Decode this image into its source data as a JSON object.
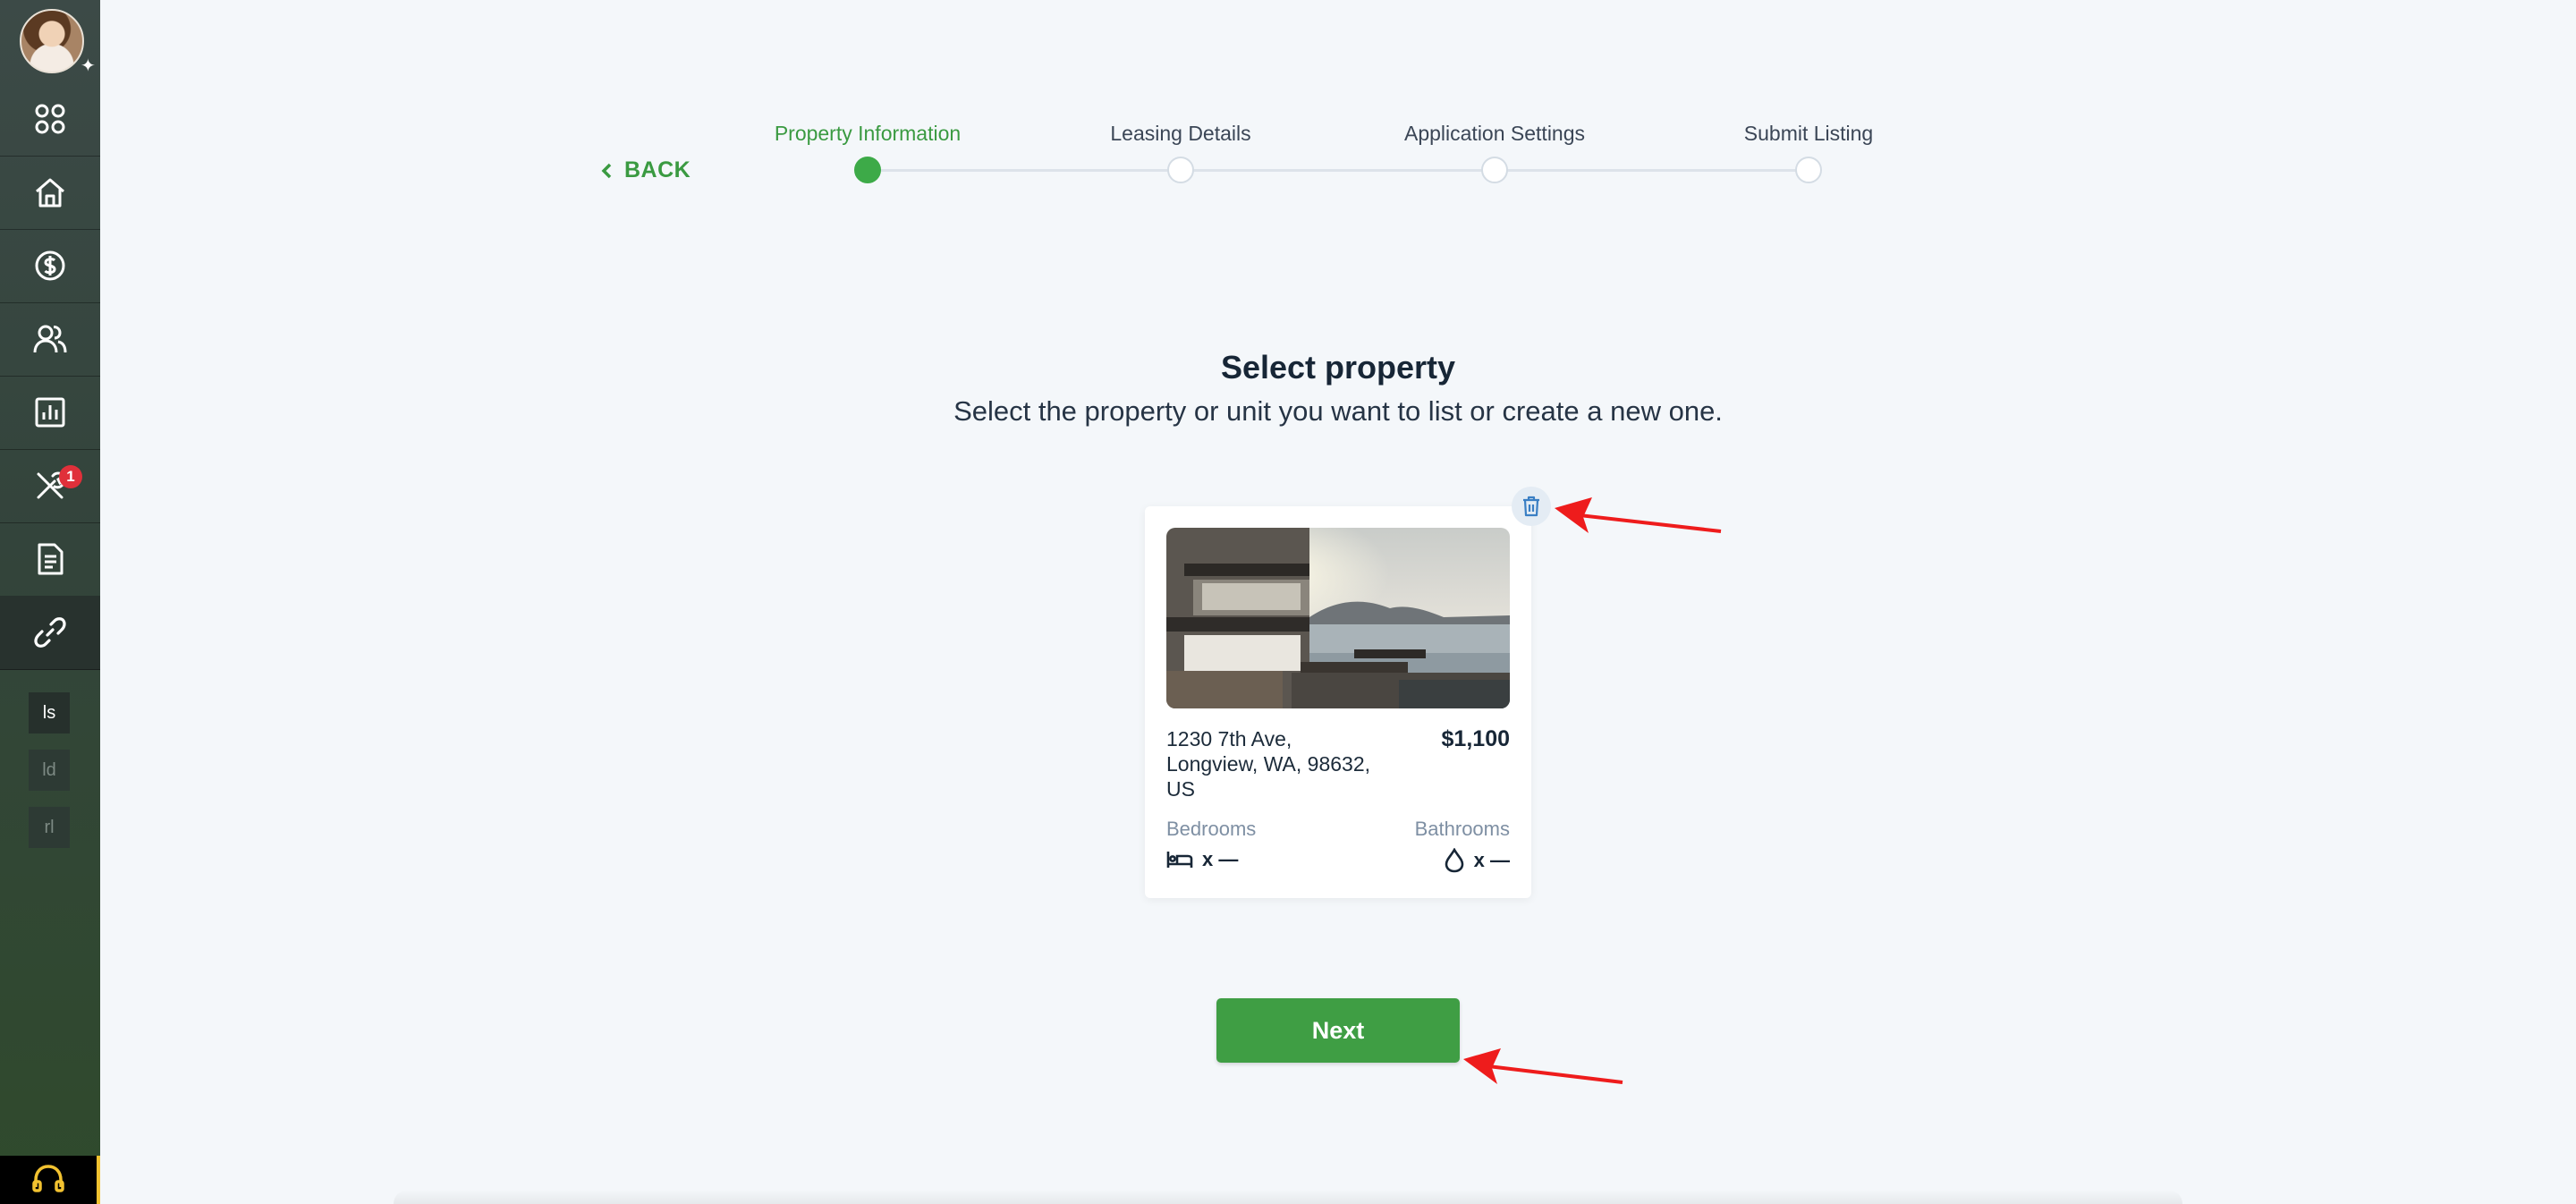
{
  "sidebar": {
    "items": [
      {
        "icon": "apps-grid-icon"
      },
      {
        "icon": "home-icon"
      },
      {
        "icon": "dollar-icon"
      },
      {
        "icon": "people-icon"
      },
      {
        "icon": "reports-chart-icon"
      },
      {
        "icon": "tools-icon",
        "badge": "1"
      },
      {
        "icon": "document-icon"
      },
      {
        "icon": "link-icon"
      }
    ],
    "mini_items": [
      "ls",
      "ld",
      "rl"
    ],
    "support_icon": "headset-icon"
  },
  "back_label": "BACK",
  "steps": [
    {
      "label": "Property Information",
      "state": "active"
    },
    {
      "label": "Leasing Details",
      "state": "pending"
    },
    {
      "label": "Application Settings",
      "state": "pending"
    },
    {
      "label": "Submit Listing",
      "state": "pending"
    }
  ],
  "heading": {
    "title": "Select property",
    "subtitle": "Select the property or unit you want to list or create a new one."
  },
  "property": {
    "address_line1": "1230 7th Ave,",
    "address_line2": "Longview, WA, 98632,",
    "address_line3": "US",
    "price": "$1,100",
    "bedrooms_label": "Bedrooms",
    "bedrooms_value": "x —",
    "bathrooms_label": "Bathrooms",
    "bathrooms_value": "x —"
  },
  "next_label": "Next",
  "colors": {
    "accent_green": "#3f9e44",
    "badge_red": "#e0303a",
    "annotation_red": "#ee1c1c"
  }
}
